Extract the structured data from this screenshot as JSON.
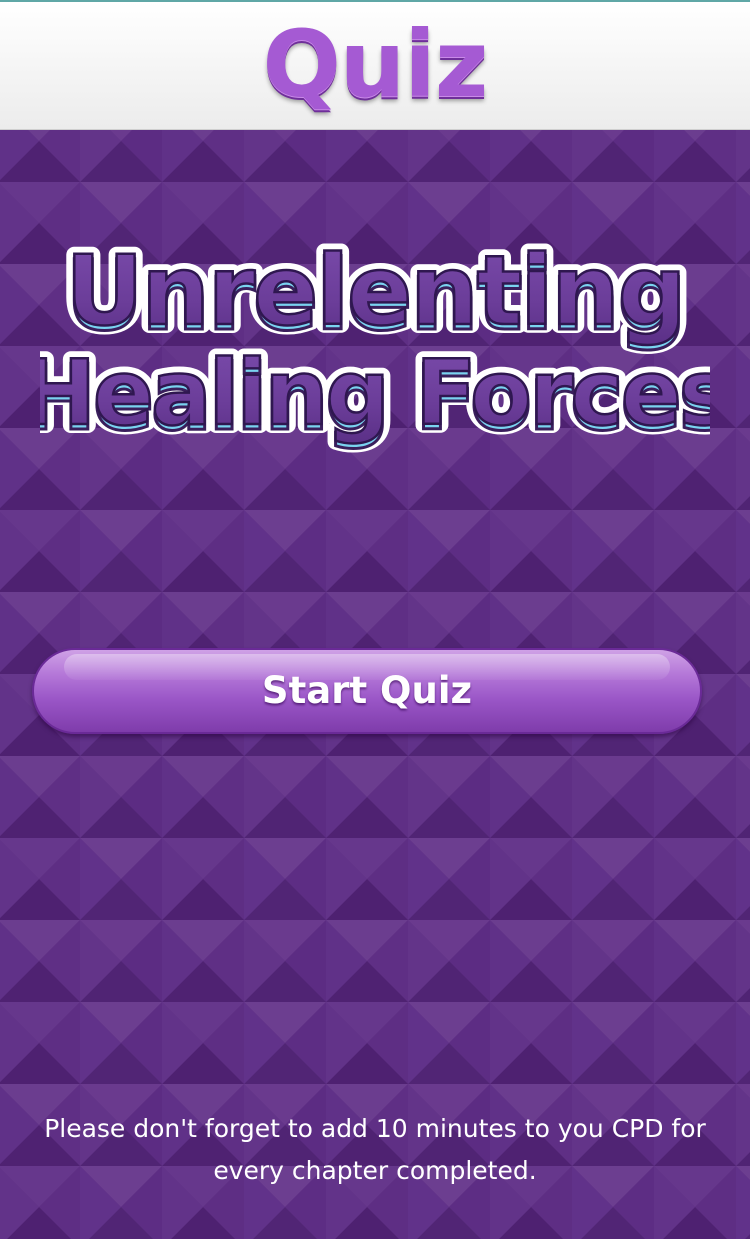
{
  "header": {
    "title": "Quiz"
  },
  "logo": {
    "line1": "Unrelenting",
    "line2": "Healing Forces"
  },
  "start_button": {
    "label": "Start Quiz"
  },
  "footer": {
    "note": "Please don't forget to add 10 minutes to you CPD for every chapter completed."
  },
  "colors": {
    "background": "#5a2e80",
    "header_title": "#a55ad3",
    "button": "#9a56c7",
    "logo_fill": "#6b3d99",
    "logo_accent": "#7ad3f0"
  }
}
